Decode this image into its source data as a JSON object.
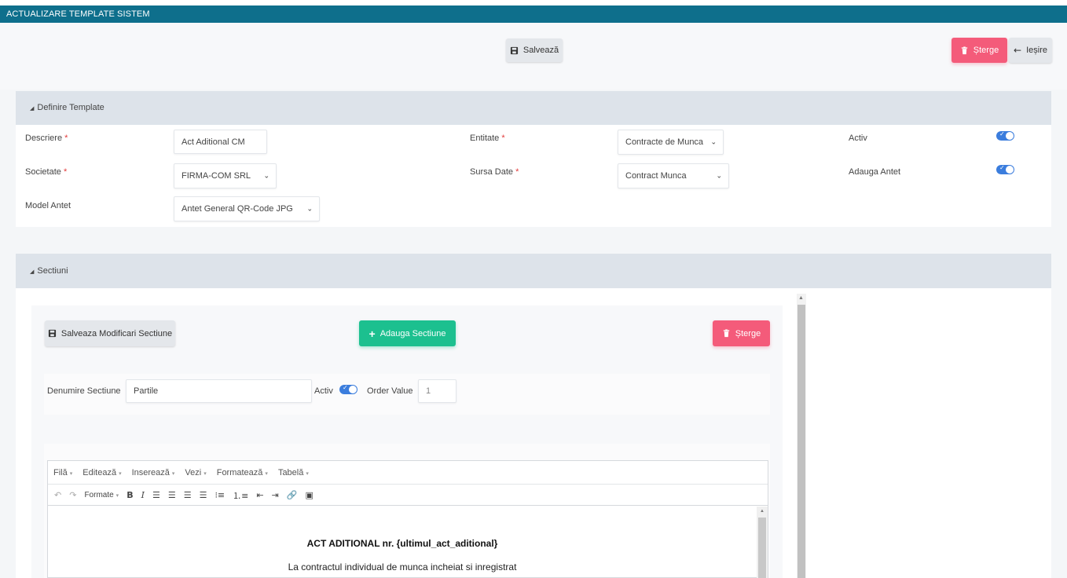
{
  "header": {
    "title": "ACTUALIZARE TEMPLATE SISTEM"
  },
  "toolbar": {
    "save_label": "Salvează",
    "delete_label": "Șterge",
    "exit_label": "Ieșire"
  },
  "definire": {
    "title": "Definire Template",
    "descriere_label": "Descriere",
    "descriere_value": "Act Aditional CM",
    "entitate_label": "Entitate",
    "entitate_value": "Contracte de Munca",
    "activ_label": "Activ",
    "societate_label": "Societate",
    "societate_value": "FIRMA-COM SRL",
    "sursa_label": "Sursa Date",
    "sursa_value": "Contract Munca",
    "antet_label": "Adauga Antet",
    "model_label": "Model Antet",
    "model_value": "Antet General QR-Code JPG",
    "required_mark": "*"
  },
  "sectiuni": {
    "title": "Sectiuni",
    "save_changes_label": "Salveaza Modificari Sectiune",
    "add_label": "Adauga Sectiune",
    "delete_label": "Șterge",
    "name_label": "Denumire Sectiune",
    "name_value": "Partile",
    "activ_label": "Activ",
    "order_label": "Order Value",
    "order_value": "1"
  },
  "editor": {
    "menu": [
      "Filă",
      "Editează",
      "Inserează",
      "Vezi",
      "Formatează",
      "Tabelă"
    ],
    "formats_label": "Formate",
    "doc_title": "ACT ADITIONAL nr. {ultimul_act_aditional}",
    "doc_line": "La contractul individual de munca incheiat si inregistrat"
  },
  "colors": {
    "header": "#0e6f8c",
    "danger": "#f45b7a",
    "success": "#1cc08f",
    "toggle": "#3b7ddd"
  }
}
